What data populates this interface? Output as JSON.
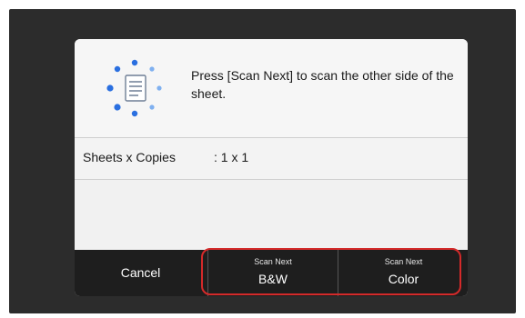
{
  "dialog": {
    "icon": "document-scanning-icon",
    "message": "Press [Scan Next] to scan the other side of the sheet.",
    "info": {
      "label": "Sheets x Copies",
      "value": ": 1 x 1"
    }
  },
  "buttons": {
    "cancel": "Cancel",
    "scan_bw": {
      "small": "Scan Next",
      "big": "B&W"
    },
    "scan_color": {
      "small": "Scan Next",
      "big": "Color"
    }
  },
  "colors": {
    "screen_bg": "#2c2c2c",
    "dialog_bg": "#f3f3f3",
    "button_bar": "#1e1e1e",
    "highlight": "#d42a2a",
    "icon_blue": "#2a6fe0"
  }
}
